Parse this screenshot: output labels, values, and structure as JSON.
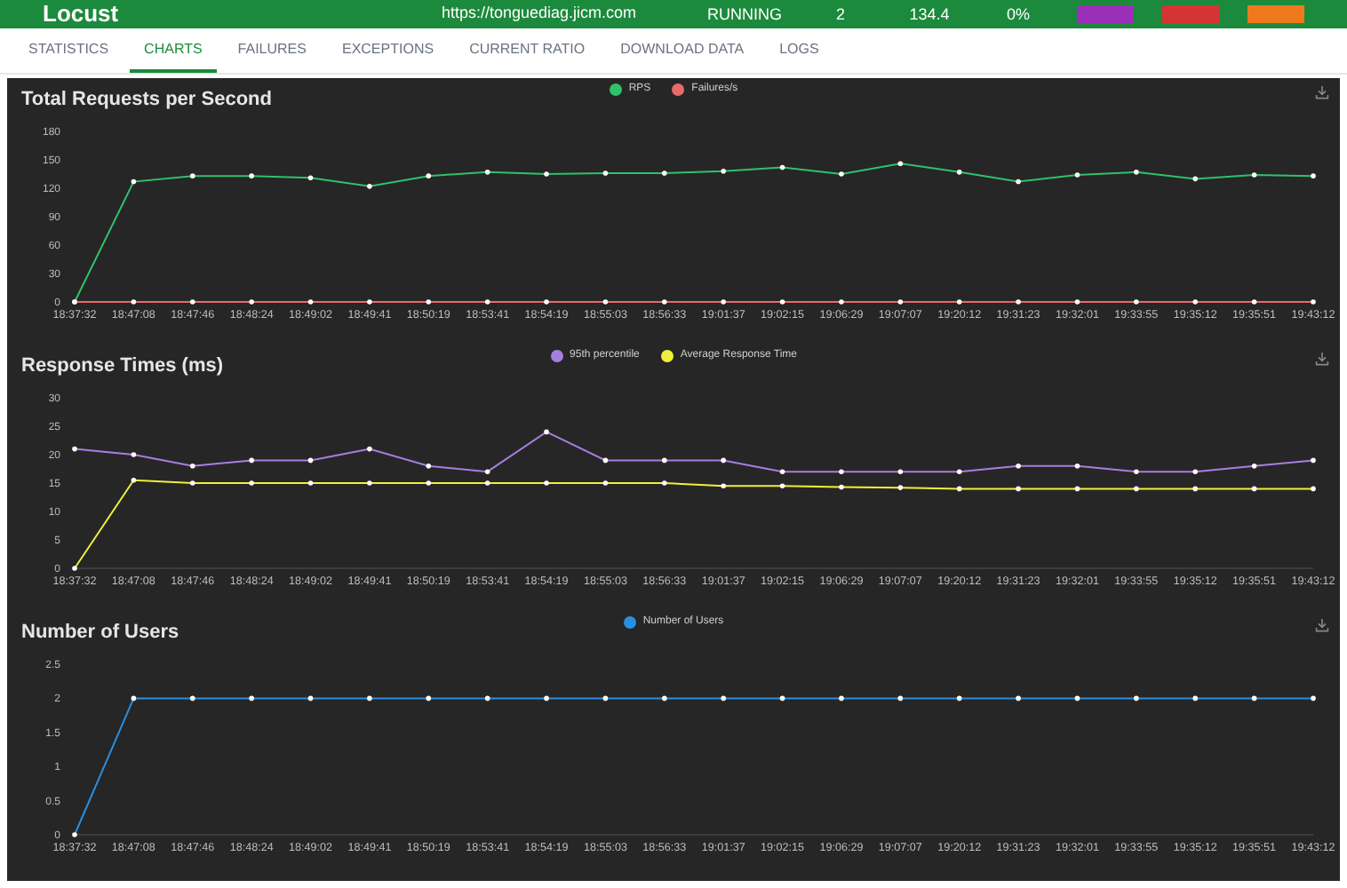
{
  "header": {
    "logo": "Locust",
    "host": "https://tonguediag.jicm.com",
    "status": "RUNNING",
    "users": "2",
    "rps": "134.4",
    "failures": "0%"
  },
  "tabs": [
    {
      "label": "STATISTICS",
      "selected": false
    },
    {
      "label": "CHARTS",
      "selected": true
    },
    {
      "label": "FAILURES",
      "selected": false
    },
    {
      "label": "EXCEPTIONS",
      "selected": false
    },
    {
      "label": "CURRENT RATIO",
      "selected": false
    },
    {
      "label": "DOWNLOAD DATA",
      "selected": false
    },
    {
      "label": "LOGS",
      "selected": false
    }
  ],
  "charts": [
    {
      "chart_data": {
        "type": "line",
        "title": "Total Requests per Second",
        "categories": [
          "18:37:32",
          "18:47:08",
          "18:47:46",
          "18:48:24",
          "18:49:02",
          "18:49:41",
          "18:50:19",
          "18:53:41",
          "18:54:19",
          "18:55:03",
          "18:56:33",
          "19:01:37",
          "19:02:15",
          "19:06:29",
          "19:07:07",
          "19:20:12",
          "19:31:23",
          "19:32:01",
          "19:33:55",
          "19:35:12",
          "19:35:51",
          "19:43:12"
        ],
        "series": [
          {
            "name": "RPS",
            "color": "#2fc26a",
            "values": [
              0,
              127,
              133,
              133,
              131,
              122,
              133,
              137,
              135,
              136,
              136,
              138,
              142,
              135,
              146,
              137,
              127,
              134,
              137,
              130,
              134,
              133
            ]
          },
          {
            "name": "Failures/s",
            "color": "#e86a6a",
            "values": [
              0,
              0,
              0,
              0,
              0,
              0,
              0,
              0,
              0,
              0,
              0,
              0,
              0,
              0,
              0,
              0,
              0,
              0,
              0,
              0,
              0,
              0
            ]
          }
        ],
        "ylim": [
          0,
          180
        ],
        "yticks": [
          0,
          30,
          60,
          90,
          120,
          150,
          180
        ]
      }
    },
    {
      "chart_data": {
        "type": "line",
        "title": "Response Times (ms)",
        "categories": [
          "18:37:32",
          "18:47:08",
          "18:47:46",
          "18:48:24",
          "18:49:02",
          "18:49:41",
          "18:50:19",
          "18:53:41",
          "18:54:19",
          "18:55:03",
          "18:56:33",
          "19:01:37",
          "19:02:15",
          "19:06:29",
          "19:07:07",
          "19:20:12",
          "19:31:23",
          "19:32:01",
          "19:33:55",
          "19:35:12",
          "19:35:51",
          "19:43:12"
        ],
        "series": [
          {
            "name": "95th percentile",
            "color": "#a77ee0",
            "values": [
              21,
              20,
              18,
              19,
              19,
              21,
              18,
              17,
              24,
              19,
              19,
              19,
              17,
              17,
              17,
              17,
              18,
              18,
              17,
              17,
              18,
              19
            ]
          },
          {
            "name": "Average Response Time",
            "color": "#f0f03a",
            "values": [
              0,
              15.5,
              15,
              15,
              15,
              15,
              15,
              15,
              15,
              15,
              15,
              14.5,
              14.5,
              14.3,
              14.2,
              14,
              14,
              14,
              14,
              14,
              14,
              14
            ]
          }
        ],
        "ylim": [
          0,
          30
        ],
        "yticks": [
          0,
          5,
          10,
          15,
          20,
          25,
          30
        ]
      }
    },
    {
      "chart_data": {
        "type": "line",
        "title": "Number of Users",
        "categories": [
          "18:37:32",
          "18:47:08",
          "18:47:46",
          "18:48:24",
          "18:49:02",
          "18:49:41",
          "18:50:19",
          "18:53:41",
          "18:54:19",
          "18:55:03",
          "18:56:33",
          "19:01:37",
          "19:02:15",
          "19:06:29",
          "19:07:07",
          "19:20:12",
          "19:31:23",
          "19:32:01",
          "19:33:55",
          "19:35:12",
          "19:35:51",
          "19:43:12"
        ],
        "series": [
          {
            "name": "Number of Users",
            "color": "#2a8fe0",
            "values": [
              0,
              2,
              2,
              2,
              2,
              2,
              2,
              2,
              2,
              2,
              2,
              2,
              2,
              2,
              2,
              2,
              2,
              2,
              2,
              2,
              2,
              2
            ]
          }
        ],
        "ylim": [
          0,
          2.5
        ],
        "yticks": [
          0,
          0.5,
          1,
          1.5,
          2,
          2.5
        ]
      }
    }
  ]
}
